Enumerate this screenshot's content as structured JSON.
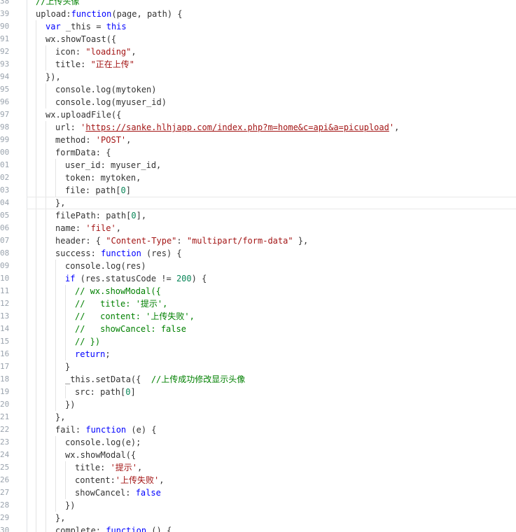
{
  "editor": {
    "colors": {
      "keyword": "#0000ff",
      "string": "#a31515",
      "number": "#098658",
      "comment": "#008000",
      "plain": "#333333",
      "line_number": "#9aa3ad"
    },
    "active_line_number": "04",
    "lines": [
      {
        "n": "38",
        "indent": 1,
        "tokens": [
          {
            "t": "//上传头像",
            "c": "c"
          }
        ]
      },
      {
        "n": "39",
        "indent": 1,
        "tokens": [
          {
            "t": "upload:",
            "c": "p"
          },
          {
            "t": "function",
            "c": "k"
          },
          {
            "t": "(page, path) {",
            "c": "p"
          }
        ]
      },
      {
        "n": "90",
        "indent": 2,
        "tokens": [
          {
            "t": "var",
            "c": "k"
          },
          {
            "t": " _this = ",
            "c": "p"
          },
          {
            "t": "this",
            "c": "k"
          }
        ]
      },
      {
        "n": "91",
        "indent": 2,
        "tokens": [
          {
            "t": "wx.showToast({",
            "c": "p"
          }
        ]
      },
      {
        "n": "92",
        "indent": 3,
        "tokens": [
          {
            "t": "icon: ",
            "c": "p"
          },
          {
            "t": "\"loading\"",
            "c": "s"
          },
          {
            "t": ",",
            "c": "p"
          }
        ]
      },
      {
        "n": "93",
        "indent": 3,
        "tokens": [
          {
            "t": "title: ",
            "c": "p"
          },
          {
            "t": "\"正在上传\"",
            "c": "s"
          }
        ]
      },
      {
        "n": "94",
        "indent": 2,
        "tokens": [
          {
            "t": "}),",
            "c": "p"
          }
        ]
      },
      {
        "n": "95",
        "indent": 3,
        "tokens": [
          {
            "t": "console.log(mytoken)",
            "c": "p"
          }
        ]
      },
      {
        "n": "96",
        "indent": 3,
        "tokens": [
          {
            "t": "console.log(myuser_id)",
            "c": "p"
          }
        ]
      },
      {
        "n": "97",
        "indent": 2,
        "tokens": [
          {
            "t": "wx.uploadFile({",
            "c": "p"
          }
        ]
      },
      {
        "n": "98",
        "indent": 3,
        "tokens": [
          {
            "t": "url: ",
            "c": "p"
          },
          {
            "t": "'",
            "c": "s"
          },
          {
            "t": "https://sanke.hlhjapp.com/index.php?m=home&c=api&a=picupload",
            "c": "u"
          },
          {
            "t": "'",
            "c": "s"
          },
          {
            "t": ",",
            "c": "p"
          }
        ]
      },
      {
        "n": "99",
        "indent": 3,
        "tokens": [
          {
            "t": "method: ",
            "c": "p"
          },
          {
            "t": "'POST'",
            "c": "s"
          },
          {
            "t": ",",
            "c": "p"
          }
        ]
      },
      {
        "n": "00",
        "indent": 3,
        "tokens": [
          {
            "t": "formData: {",
            "c": "p"
          }
        ]
      },
      {
        "n": "01",
        "indent": 4,
        "tokens": [
          {
            "t": "user_id: myuser_id,",
            "c": "p"
          }
        ]
      },
      {
        "n": "02",
        "indent": 4,
        "tokens": [
          {
            "t": "token: mytoken,",
            "c": "p"
          }
        ]
      },
      {
        "n": "03",
        "indent": 4,
        "tokens": [
          {
            "t": "file: path[",
            "c": "p"
          },
          {
            "t": "0",
            "c": "n"
          },
          {
            "t": "]",
            "c": "p"
          }
        ]
      },
      {
        "n": "04",
        "indent": 3,
        "tokens": [
          {
            "t": "},",
            "c": "p"
          }
        ]
      },
      {
        "n": "05",
        "indent": 3,
        "tokens": [
          {
            "t": "filePath: path[",
            "c": "p"
          },
          {
            "t": "0",
            "c": "n"
          },
          {
            "t": "],",
            "c": "p"
          }
        ]
      },
      {
        "n": "06",
        "indent": 3,
        "tokens": [
          {
            "t": "name: ",
            "c": "p"
          },
          {
            "t": "'file'",
            "c": "s"
          },
          {
            "t": ",",
            "c": "p"
          }
        ]
      },
      {
        "n": "07",
        "indent": 3,
        "tokens": [
          {
            "t": "header: { ",
            "c": "p"
          },
          {
            "t": "\"Content-Type\"",
            "c": "s"
          },
          {
            "t": ": ",
            "c": "p"
          },
          {
            "t": "\"multipart/form-data\"",
            "c": "s"
          },
          {
            "t": " },",
            "c": "p"
          }
        ]
      },
      {
        "n": "08",
        "indent": 3,
        "tokens": [
          {
            "t": "success: ",
            "c": "p"
          },
          {
            "t": "function",
            "c": "k"
          },
          {
            "t": " (res) {",
            "c": "p"
          }
        ]
      },
      {
        "n": "09",
        "indent": 4,
        "tokens": [
          {
            "t": "console.log(res)",
            "c": "p"
          }
        ]
      },
      {
        "n": "10",
        "indent": 4,
        "tokens": [
          {
            "t": "if",
            "c": "k"
          },
          {
            "t": " (res.statusCode != ",
            "c": "p"
          },
          {
            "t": "200",
            "c": "n"
          },
          {
            "t": ") {",
            "c": "p"
          }
        ]
      },
      {
        "n": "11",
        "indent": 5,
        "tokens": [
          {
            "t": "// wx.showModal({",
            "c": "c"
          }
        ]
      },
      {
        "n": "12",
        "indent": 5,
        "tokens": [
          {
            "t": "//   title: '提示',",
            "c": "c"
          }
        ]
      },
      {
        "n": "13",
        "indent": 5,
        "tokens": [
          {
            "t": "//   content: '上传失败',",
            "c": "c"
          }
        ]
      },
      {
        "n": "14",
        "indent": 5,
        "tokens": [
          {
            "t": "//   showCancel: false",
            "c": "c"
          }
        ]
      },
      {
        "n": "15",
        "indent": 5,
        "tokens": [
          {
            "t": "// })",
            "c": "c"
          }
        ]
      },
      {
        "n": "16",
        "indent": 5,
        "tokens": [
          {
            "t": "return",
            "c": "k"
          },
          {
            "t": ";",
            "c": "p"
          }
        ]
      },
      {
        "n": "17",
        "indent": 4,
        "tokens": [
          {
            "t": "}",
            "c": "p"
          }
        ]
      },
      {
        "n": "18",
        "indent": 4,
        "tokens": [
          {
            "t": "_this.setData({  ",
            "c": "p"
          },
          {
            "t": "//上传成功修改显示头像",
            "c": "c"
          }
        ]
      },
      {
        "n": "19",
        "indent": 5,
        "tokens": [
          {
            "t": "src: path[",
            "c": "p"
          },
          {
            "t": "0",
            "c": "n"
          },
          {
            "t": "]",
            "c": "p"
          }
        ]
      },
      {
        "n": "20",
        "indent": 4,
        "tokens": [
          {
            "t": "})",
            "c": "p"
          }
        ]
      },
      {
        "n": "21",
        "indent": 3,
        "tokens": [
          {
            "t": "},",
            "c": "p"
          }
        ]
      },
      {
        "n": "22",
        "indent": 3,
        "tokens": [
          {
            "t": "fail: ",
            "c": "p"
          },
          {
            "t": "function",
            "c": "k"
          },
          {
            "t": " (e) {",
            "c": "p"
          }
        ]
      },
      {
        "n": "23",
        "indent": 4,
        "tokens": [
          {
            "t": "console.log(e);",
            "c": "p"
          }
        ]
      },
      {
        "n": "24",
        "indent": 4,
        "tokens": [
          {
            "t": "wx.showModal({",
            "c": "p"
          }
        ]
      },
      {
        "n": "25",
        "indent": 5,
        "tokens": [
          {
            "t": "title: ",
            "c": "p"
          },
          {
            "t": "'提示'",
            "c": "s"
          },
          {
            "t": ",",
            "c": "p"
          }
        ]
      },
      {
        "n": "26",
        "indent": 5,
        "tokens": [
          {
            "t": "content:",
            "c": "p"
          },
          {
            "t": "'上传失败'",
            "c": "s"
          },
          {
            "t": ",",
            "c": "p"
          }
        ]
      },
      {
        "n": "27",
        "indent": 5,
        "tokens": [
          {
            "t": "showCancel: ",
            "c": "p"
          },
          {
            "t": "false",
            "c": "k"
          }
        ]
      },
      {
        "n": "28",
        "indent": 4,
        "tokens": [
          {
            "t": "})",
            "c": "p"
          }
        ]
      },
      {
        "n": "29",
        "indent": 3,
        "tokens": [
          {
            "t": "},",
            "c": "p"
          }
        ]
      },
      {
        "n": "30",
        "indent": 3,
        "tokens": [
          {
            "t": "complete: ",
            "c": "p"
          },
          {
            "t": "function",
            "c": "k"
          },
          {
            "t": " () {",
            "c": "p"
          }
        ]
      }
    ]
  }
}
